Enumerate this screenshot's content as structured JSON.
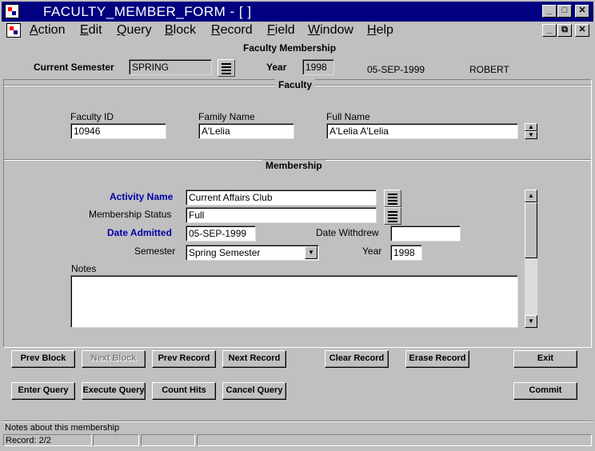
{
  "window": {
    "title": "FACULTY_MEMBER_FORM - [ ]",
    "minimize_glyph": "_",
    "maximize_glyph": "□",
    "restore_glyph": "⧉",
    "close_glyph": "✕"
  },
  "menu": [
    {
      "label": "Action",
      "accel": "A",
      "rest": "ction"
    },
    {
      "label": "Edit",
      "accel": "E",
      "rest": "dit"
    },
    {
      "label": "Query",
      "accel": "Q",
      "rest": "uery"
    },
    {
      "label": "Block",
      "accel": "B",
      "rest": "lock"
    },
    {
      "label": "Record",
      "accel": "R",
      "rest": "ecord"
    },
    {
      "label": "Field",
      "accel": "F",
      "rest": "ield"
    },
    {
      "label": "Window",
      "accel": "W",
      "rest": "indow"
    },
    {
      "label": "Help",
      "accel": "H",
      "rest": "elp"
    }
  ],
  "header": {
    "form_title": "Faculty Membership",
    "current_semester_label": "Current Semester",
    "current_semester_value": "SPRING",
    "year_label": "Year",
    "year_value": "1998",
    "date": "05-SEP-1999",
    "user": "ROBERT"
  },
  "faculty": {
    "section_title": "Faculty",
    "faculty_id_label": "Faculty ID",
    "faculty_id_value": "10946",
    "family_name_label": "Family Name",
    "family_name_value": "A'Lelia",
    "full_name_label": "Full Name",
    "full_name_value": "A'Lelia  A'Lelia"
  },
  "membership": {
    "section_title": "Membership",
    "activity_name_label": "Activity Name",
    "activity_name_value": "Current Affairs Club",
    "membership_status_label": "Membership Status",
    "membership_status_value": "Full",
    "date_admitted_label": "Date Admitted",
    "date_admitted_value": "05-SEP-1999",
    "date_withdrew_label": "Date Withdrew",
    "date_withdrew_value": "",
    "semester_label": "Semester",
    "semester_value": "Spring Semester",
    "year_label": "Year",
    "year_value": "1998",
    "notes_label": "Notes",
    "notes_value": ""
  },
  "buttons": {
    "prev_block": "Prev Block",
    "next_block": "Next Block",
    "prev_record": "Prev Record",
    "next_record": "Next Record",
    "clear_record": "Clear Record",
    "erase_record": "Erase Record",
    "exit": "Exit",
    "enter_query": "Enter Query",
    "execute_query": "Execute Query",
    "count_hits": "Count Hits",
    "cancel_query": "Cancel Query",
    "commit": "Commit"
  },
  "status": {
    "hint": "Notes about this membership",
    "record": "Record: 2/2"
  },
  "colors": {
    "titlebar": "#000080",
    "required_label": "#0000a8",
    "face": "#c0c0c0"
  }
}
